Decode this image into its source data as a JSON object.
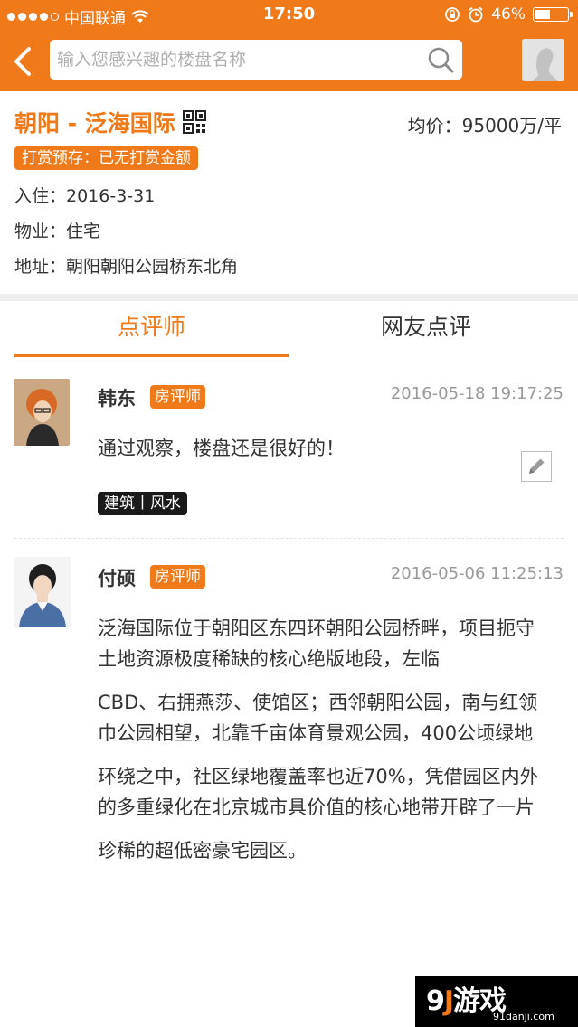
{
  "status_bar": {
    "carrier": "中国联通",
    "time": "17:50",
    "battery": "46%",
    "battery_level": 0.46
  },
  "search": {
    "placeholder": "输入您感兴趣的楼盘名称"
  },
  "property": {
    "title": "朝阳 - 泛海国际",
    "price": "均价：95000万/平",
    "reward": "打赏预存：已无打赏金额",
    "move_in": "入住：2016-3-31",
    "property_type": "物业：住宅",
    "address": "地址：朝阳朝阳公园桥东北角"
  },
  "tabs": [
    {
      "label": "点评师",
      "active": true
    },
    {
      "label": "网友点评",
      "active": false
    }
  ],
  "reviews": [
    {
      "name": "韩东",
      "badge": "房评师",
      "time": "2016-05-18 19:17:25",
      "paragraphs": [
        "通过观察，楼盘还是很好的！"
      ],
      "tags": "建筑丨风水"
    },
    {
      "name": "付硕",
      "badge": "房评师",
      "time": "2016-05-06 11:25:13",
      "paragraphs": [
        "泛海国际位于朝阳区东四环朝阳公园桥畔，项目扼守土地资源极度稀缺的核心绝版地段，左临",
        "CBD、右拥燕莎、使馆区；西邻朝阳公园，南与红领巾公园相望，北靠千亩体育景观公园，400公顷绿地",
        "环绕之中，社区绿地覆盖率也近70%，凭借园区内外的多重绿化在北京城市具价值的核心地带开辟了一片",
        "珍稀的超低密豪宅园区。"
      ]
    }
  ],
  "watermark": {
    "logo_a": "9",
    "logo_b": "J",
    "logo_c": "游戏",
    "sub": "91danji.com"
  },
  "colors": {
    "brand": "#f07a19"
  }
}
